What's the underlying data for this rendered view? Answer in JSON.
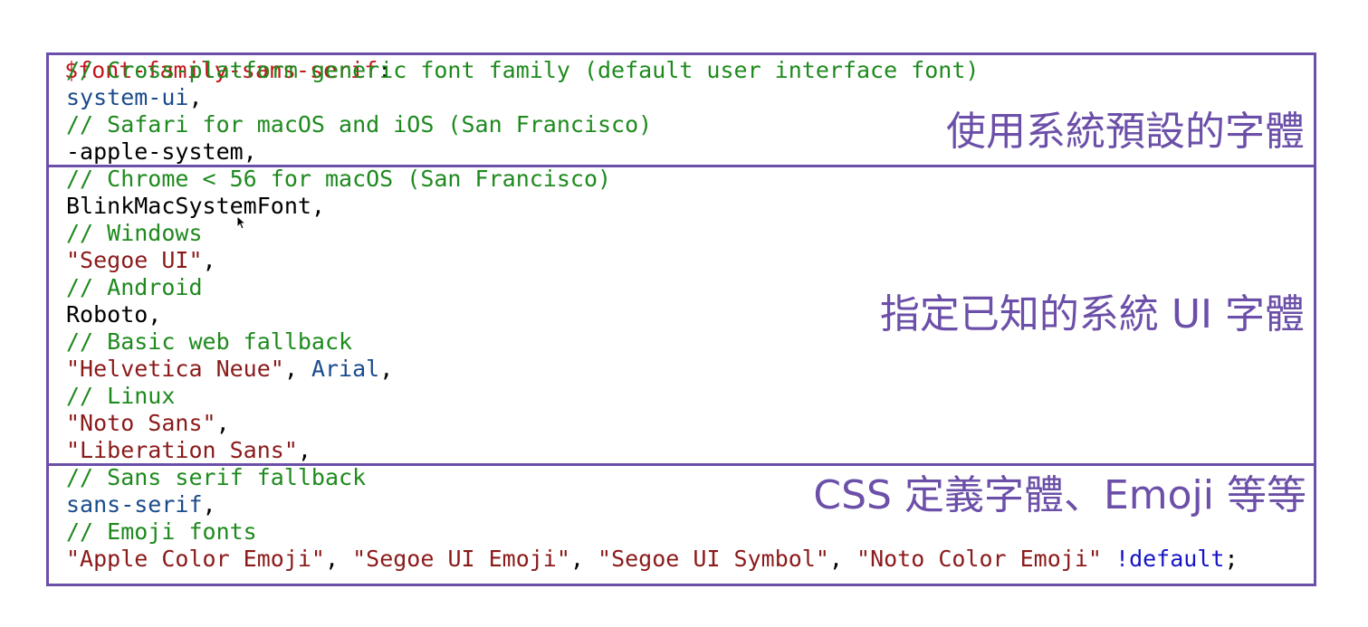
{
  "header": {
    "variable": "$font-family-sans-serif",
    "colon": ":"
  },
  "blocks": [
    {
      "annotation": "使用系統預設的字體",
      "lines": [
        [
          {
            "t": "comment",
            "text": "// Cross-platform generic font family (default user interface font)"
          }
        ],
        [
          {
            "t": "keyword",
            "text": "system-ui"
          },
          {
            "t": "plain",
            "text": ","
          }
        ],
        [
          {
            "t": "comment",
            "text": "// Safari for macOS and iOS (San Francisco)"
          }
        ],
        [
          {
            "t": "plain",
            "text": "-apple-system,"
          }
        ]
      ]
    },
    {
      "annotation": "指定已知的系統 UI 字體",
      "lines": [
        [
          {
            "t": "comment",
            "text": "// Chrome < 56 for macOS (San Francisco)"
          }
        ],
        [
          {
            "t": "plain",
            "text": "BlinkMacSystemFont,"
          }
        ],
        [
          {
            "t": "comment",
            "text": "// Windows"
          }
        ],
        [
          {
            "t": "string",
            "text": "\"Segoe UI\""
          },
          {
            "t": "plain",
            "text": ","
          }
        ],
        [
          {
            "t": "comment",
            "text": "// Android"
          }
        ],
        [
          {
            "t": "plain",
            "text": "Roboto,"
          }
        ],
        [
          {
            "t": "comment",
            "text": "// Basic web fallback"
          }
        ],
        [
          {
            "t": "string",
            "text": "\"Helvetica Neue\""
          },
          {
            "t": "plain",
            "text": ", "
          },
          {
            "t": "keyword",
            "text": "Arial"
          },
          {
            "t": "plain",
            "text": ","
          }
        ],
        [
          {
            "t": "comment",
            "text": "// Linux"
          }
        ],
        [
          {
            "t": "string",
            "text": "\"Noto Sans\""
          },
          {
            "t": "plain",
            "text": ","
          }
        ],
        [
          {
            "t": "string",
            "text": "\"Liberation Sans\""
          },
          {
            "t": "plain",
            "text": ","
          }
        ]
      ]
    },
    {
      "annotation": "CSS 定義字體、Emoji 等等",
      "lines": [
        [
          {
            "t": "comment",
            "text": "// Sans serif fallback"
          }
        ],
        [
          {
            "t": "keyword",
            "text": "sans-serif"
          },
          {
            "t": "plain",
            "text": ","
          }
        ],
        [
          {
            "t": "comment",
            "text": "// Emoji fonts"
          }
        ],
        [
          {
            "t": "string",
            "text": "\"Apple Color Emoji\""
          },
          {
            "t": "plain",
            "text": ", "
          },
          {
            "t": "string",
            "text": "\"Segoe UI Emoji\""
          },
          {
            "t": "plain",
            "text": ", "
          },
          {
            "t": "string",
            "text": "\"Segoe UI Symbol\""
          },
          {
            "t": "plain",
            "text": ", "
          },
          {
            "t": "string",
            "text": "\"Noto Color Emoji\""
          },
          {
            "t": "plain",
            "text": " "
          },
          {
            "t": "flag",
            "text": "!default"
          },
          {
            "t": "plain",
            "text": ";"
          }
        ]
      ]
    }
  ],
  "colors": {
    "variable": "#c4161c",
    "comment": "#1e8a1e",
    "keyword": "#1a4b8c",
    "string": "#8b1a1a",
    "plain": "#000000",
    "flag": "#1414c8",
    "annotation_box": "#6b4fa8"
  },
  "icons": {
    "cursor": "mouse-pointer-icon"
  }
}
